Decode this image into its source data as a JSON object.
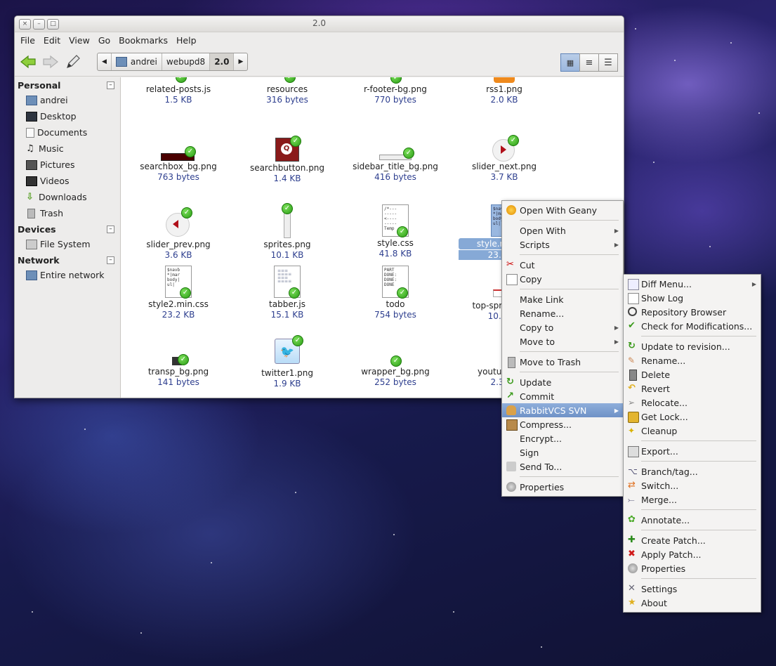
{
  "window": {
    "title": "2.0",
    "buttons": {
      "close": "×",
      "minimize": "–",
      "maximize": "□"
    }
  },
  "menubar": [
    "File",
    "Edit",
    "View",
    "Go",
    "Bookmarks",
    "Help"
  ],
  "pathbar": {
    "crumbs": [
      "andrei",
      "webupd8",
      "2.0"
    ]
  },
  "sidebar": {
    "sections": [
      {
        "title": "Personal",
        "collapse": "–",
        "items": [
          {
            "label": "andrei",
            "icon": "home-folder-icon"
          },
          {
            "label": "Desktop",
            "icon": "desktop-icon"
          },
          {
            "label": "Documents",
            "icon": "documents-icon"
          },
          {
            "label": "Music",
            "icon": "music-icon"
          },
          {
            "label": "Pictures",
            "icon": "pictures-icon"
          },
          {
            "label": "Videos",
            "icon": "videos-icon"
          },
          {
            "label": "Downloads",
            "icon": "downloads-icon"
          },
          {
            "label": "Trash",
            "icon": "trash-icon"
          }
        ]
      },
      {
        "title": "Devices",
        "collapse": "–",
        "items": [
          {
            "label": "File System",
            "icon": "harddisk-icon"
          }
        ]
      },
      {
        "title": "Network",
        "collapse": "–",
        "items": [
          {
            "label": "Entire network",
            "icon": "network-icon"
          }
        ]
      }
    ]
  },
  "files": [
    {
      "name": "related-posts.js",
      "size": "1.5 KB"
    },
    {
      "name": "resources",
      "size": "316 bytes"
    },
    {
      "name": "r-footer-bg.png",
      "size": "770 bytes"
    },
    {
      "name": "rss1.png",
      "size": "2.0 KB"
    },
    {
      "name": "searchbox_bg.png",
      "size": "763 bytes"
    },
    {
      "name": "searchbutton.png",
      "size": "1.4 KB"
    },
    {
      "name": "sidebar_title_bg.png",
      "size": "416 bytes"
    },
    {
      "name": "slider_next.png",
      "size": "3.7 KB"
    },
    {
      "name": "slider_prev.png",
      "size": "3.6 KB"
    },
    {
      "name": "sprites.png",
      "size": "10.1 KB"
    },
    {
      "name": "style.css",
      "size": "41.8 KB"
    },
    {
      "name": "style.min.css",
      "size": "23.2 KB"
    },
    {
      "name": "style2.min.css",
      "size": "23.2 KB"
    },
    {
      "name": "tabber.js",
      "size": "15.1 KB"
    },
    {
      "name": "todo",
      "size": "754 bytes"
    },
    {
      "name": "top-sprites.png",
      "size": "10.1 KB"
    },
    {
      "name": "transp_bg.png",
      "size": "141 bytes"
    },
    {
      "name": "twitter1.png",
      "size": "1.9 KB"
    },
    {
      "name": "wrapper_bg.png",
      "size": "252 bytes"
    },
    {
      "name": "youtube.png",
      "size": "2.3 KB"
    }
  ],
  "context_menu": [
    {
      "label": "Open With Geany",
      "icon": "geany-icon"
    },
    {
      "sep": true
    },
    {
      "label": "Open With",
      "submenu": true
    },
    {
      "label": "Scripts",
      "submenu": true
    },
    {
      "sep": true
    },
    {
      "label": "Cut",
      "icon": "scissors-icon"
    },
    {
      "label": "Copy",
      "icon": "copy-icon"
    },
    {
      "sep": true
    },
    {
      "label": "Make Link"
    },
    {
      "label": "Rename..."
    },
    {
      "label": "Copy to",
      "submenu": true
    },
    {
      "label": "Move to",
      "submenu": true
    },
    {
      "sep": true
    },
    {
      "label": "Move to Trash",
      "icon": "trash-icon"
    },
    {
      "sep": true
    },
    {
      "label": "Update",
      "icon": "update-icon"
    },
    {
      "label": "Commit",
      "icon": "commit-icon"
    },
    {
      "label": "RabbitVCS SVN",
      "icon": "rabbitvcs-icon",
      "submenu": true,
      "highlighted": true
    },
    {
      "label": "Compress...",
      "icon": "archive-icon"
    },
    {
      "label": "Encrypt..."
    },
    {
      "label": "Sign"
    },
    {
      "label": "Send To...",
      "icon": "send-icon"
    },
    {
      "sep": true
    },
    {
      "label": "Properties",
      "icon": "properties-icon"
    }
  ],
  "svn_menu": [
    {
      "label": "Diff Menu...",
      "icon": "diff-icon",
      "submenu": true
    },
    {
      "label": "Show Log",
      "icon": "log-icon"
    },
    {
      "label": "Repository Browser",
      "icon": "magnifier-icon"
    },
    {
      "label": "Check for Modifications...",
      "icon": "check-mods-icon"
    },
    {
      "sep": true
    },
    {
      "label": "Update to revision...",
      "icon": "update-icon"
    },
    {
      "label": "Rename...",
      "icon": "rename-icon"
    },
    {
      "label": "Delete",
      "icon": "delete-icon"
    },
    {
      "label": "Revert",
      "icon": "revert-icon"
    },
    {
      "label": "Relocate...",
      "icon": "relocate-icon"
    },
    {
      "label": "Get Lock...",
      "icon": "lock-icon"
    },
    {
      "label": "Cleanup",
      "icon": "broom-icon"
    },
    {
      "sep": true
    },
    {
      "label": "Export...",
      "icon": "export-icon"
    },
    {
      "sep": true
    },
    {
      "label": "Branch/tag...",
      "icon": "branch-icon"
    },
    {
      "label": "Switch...",
      "icon": "switch-icon"
    },
    {
      "label": "Merge...",
      "icon": "merge-icon"
    },
    {
      "sep": true
    },
    {
      "label": "Annotate...",
      "icon": "annotate-icon"
    },
    {
      "sep": true
    },
    {
      "label": "Create Patch...",
      "icon": "create-patch-icon"
    },
    {
      "label": "Apply Patch...",
      "icon": "apply-patch-icon"
    },
    {
      "label": "Properties",
      "icon": "properties-icon"
    },
    {
      "sep": true
    },
    {
      "label": "Settings",
      "icon": "settings-icon"
    },
    {
      "label": "About",
      "icon": "about-icon"
    }
  ],
  "colors": {
    "selection": "#86a9d6",
    "menu_highlight": "#7a9ccf",
    "svn_ok": "#2a9b14",
    "size_text": "#2e3f8f"
  }
}
